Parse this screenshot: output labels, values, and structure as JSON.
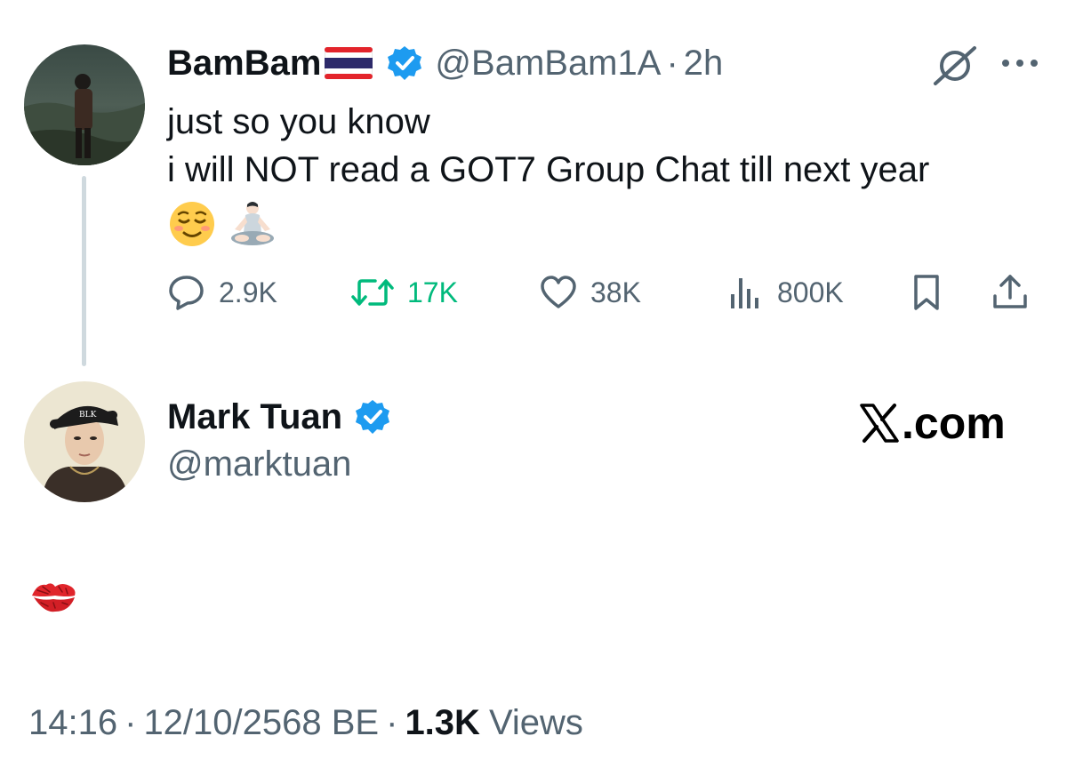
{
  "tweet": {
    "author_name": "BamBam",
    "flag": "thailand-flag",
    "verified": true,
    "handle": "@BamBam1A",
    "separator": "·",
    "time": "2h",
    "text_line1": "just so you know",
    "text_line2": "i will NOT read a GOT7 Group Chat till next year",
    "emojis": [
      "relieved-face",
      "person-in-lotus-position"
    ],
    "header_icons": [
      "grok-icon",
      "more-icon"
    ],
    "actions": {
      "replies": "2.9K",
      "retweets": "17K",
      "likes": "38K",
      "views": "800K"
    },
    "retweet_color": "#00ba7c"
  },
  "reply": {
    "author_name": "Mark Tuan",
    "verified": true,
    "handle": "@marktuan",
    "brand": ".com",
    "body_emoji": "kiss-mark",
    "footer": {
      "time": "14:16",
      "sep": "·",
      "date": "12/10/2568 BE",
      "views_count": "1.3K",
      "views_label": "Views"
    }
  },
  "colors": {
    "text_primary": "#0f1419",
    "text_secondary": "#536471",
    "verified_blue": "#1d9bf0",
    "thread_line": "#cfd9de"
  }
}
